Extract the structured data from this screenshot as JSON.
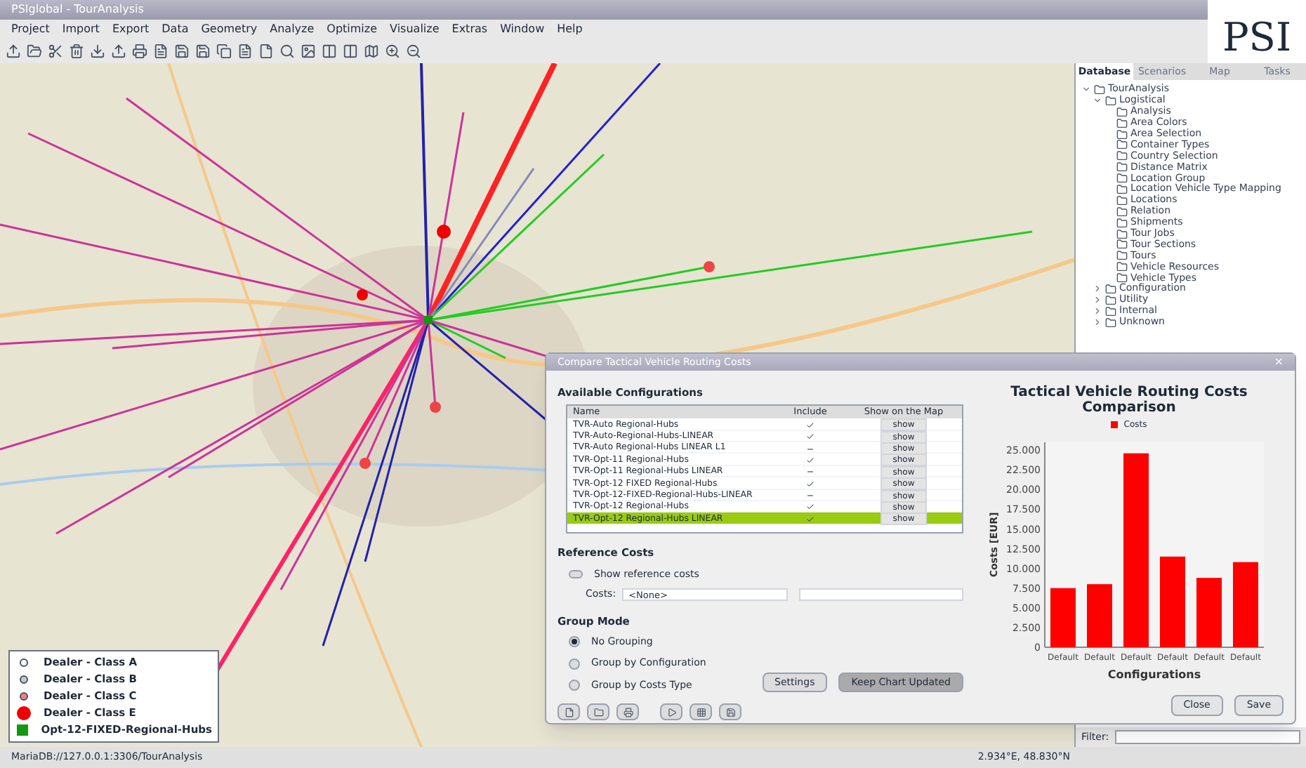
{
  "window": {
    "title": "PSIglobal - TourAnalysis"
  },
  "menu": [
    "Project",
    "Import",
    "Export",
    "Data",
    "Geometry",
    "Analyze",
    "Optimize",
    "Visualize",
    "Extras",
    "Window",
    "Help"
  ],
  "logo": {
    "text": "PSI"
  },
  "side_panel": {
    "tabs": [
      {
        "label": "Database",
        "selected": true
      },
      {
        "label": "Scenarios",
        "selected": false
      },
      {
        "label": "Map",
        "selected": false
      },
      {
        "label": "Tasks",
        "selected": false
      }
    ],
    "tree": [
      {
        "label": "TourAnalysis",
        "expanded": true,
        "children": [
          {
            "label": "Logistical",
            "expanded": true,
            "children": [
              {
                "label": "Analysis"
              },
              {
                "label": "Area Colors"
              },
              {
                "label": "Area Selection"
              },
              {
                "label": "Container Types"
              },
              {
                "label": "Country Selection"
              },
              {
                "label": "Distance Matrix"
              },
              {
                "label": "Location Group"
              },
              {
                "label": "Location Vehicle Type Mapping"
              },
              {
                "label": "Locations"
              },
              {
                "label": "Relation"
              },
              {
                "label": "Shipments"
              },
              {
                "label": "Tour Jobs"
              },
              {
                "label": "Tour Sections"
              },
              {
                "label": "Tours"
              },
              {
                "label": "Vehicle Resources"
              },
              {
                "label": "Vehicle Types"
              }
            ]
          },
          {
            "label": "Configuration",
            "expanded": false
          },
          {
            "label": "Utility",
            "expanded": false
          },
          {
            "label": "Internal",
            "expanded": false
          },
          {
            "label": "Unknown",
            "expanded": false
          }
        ]
      }
    ],
    "filter": {
      "label": "Filter:"
    }
  },
  "legend": [
    {
      "label": "Dealer - Class A",
      "kind": "circle-small",
      "color": "#ffffff"
    },
    {
      "label": "Dealer - Class B",
      "kind": "circle-small",
      "color": "#c8c8c8"
    },
    {
      "label": "Dealer - Class C",
      "kind": "circle-small",
      "color": "#f08080"
    },
    {
      "label": "Dealer - Class E",
      "kind": "circle-large",
      "color": "#ee0000"
    },
    {
      "label": "Opt-12-FIXED-Regional-Hubs",
      "kind": "square",
      "color": "#119911"
    }
  ],
  "dialog": {
    "title": "Compare Tactical Vehicle Routing Costs",
    "close": "×",
    "configurations": {
      "heading": "Available Configurations",
      "columns": [
        "Name",
        "Include",
        "Show on the Map"
      ],
      "rows": [
        {
          "name": "TVR-Auto Regional-Hubs",
          "included": true,
          "button": "show",
          "selected": false
        },
        {
          "name": "TVR-Auto-Regional-Hubs-LINEAR",
          "included": true,
          "button": "show",
          "selected": false
        },
        {
          "name": "TVR-Auto Regional-Hubs LINEAR L1",
          "included": false,
          "button": "show",
          "selected": false
        },
        {
          "name": "TVR-Opt-11 Regional-Hubs",
          "included": true,
          "button": "show",
          "selected": false
        },
        {
          "name": "TVR-Opt-11 Regional-Hubs LINEAR",
          "included": false,
          "button": "show",
          "selected": false
        },
        {
          "name": "TVR-Opt-12 FIXED Regional-Hubs",
          "included": true,
          "button": "show",
          "selected": false
        },
        {
          "name": "TVR-Opt-12-FIXED-Regional-Hubs-LINEAR",
          "included": false,
          "button": "show",
          "selected": false
        },
        {
          "name": "TVR-Opt-12 Regional-Hubs",
          "included": true,
          "button": "show",
          "selected": false
        },
        {
          "name": "TVR-Opt-12 Regional-Hubs LINEAR",
          "included": true,
          "button": "show",
          "selected": true
        }
      ]
    },
    "reference": {
      "heading": "Reference Costs",
      "checkbox": {
        "label": "Show reference costs",
        "checked": false
      },
      "costs_label": "Costs:",
      "costs_value": "<None>"
    },
    "group_mode": {
      "heading": "Group Mode",
      "options": [
        {
          "label": "No Grouping",
          "selected": true
        },
        {
          "label": "Group by Configuration",
          "selected": false
        },
        {
          "label": "Group by Costs Type",
          "selected": false
        }
      ]
    },
    "buttons": [
      "Settings",
      "Keep Chart Updated"
    ],
    "footer_buttons": [
      "Close",
      "Save"
    ],
    "chart": {
      "chart_data": {
        "type": "bar",
        "title": "Tactical Vehicle Routing Costs Comparison",
        "xlabel": "Configurations",
        "ylabel": "Costs [EUR]",
        "categories": [
          "Default",
          "Default",
          "Default",
          "Default",
          "Default",
          "Default"
        ],
        "series": [
          {
            "name": "Costs",
            "color": "#ff0000",
            "values": [
              7500,
              8000,
              24600,
              11500,
              8800,
              10800
            ]
          }
        ],
        "ylim": [
          0,
          26000
        ],
        "yticks": [
          {
            "value": 0,
            "label": "0"
          },
          {
            "value": 2500,
            "label": "2.500"
          },
          {
            "value": 5000,
            "label": "5.000"
          },
          {
            "value": 7500,
            "label": "7.500"
          },
          {
            "value": 10000,
            "label": "10.000"
          },
          {
            "value": 12500,
            "label": "12.500"
          },
          {
            "value": 15000,
            "label": "15.000"
          },
          {
            "value": 17500,
            "label": "17.500"
          },
          {
            "value": 20000,
            "label": "20.000"
          },
          {
            "value": 22500,
            "label": "22.500"
          },
          {
            "value": 25000,
            "label": "25.000"
          }
        ]
      }
    }
  },
  "status_bar": {
    "left": "MariaDB://127.0.0.1:3306/TourAnalysis",
    "right": "2.934°E, 48.830°N"
  }
}
